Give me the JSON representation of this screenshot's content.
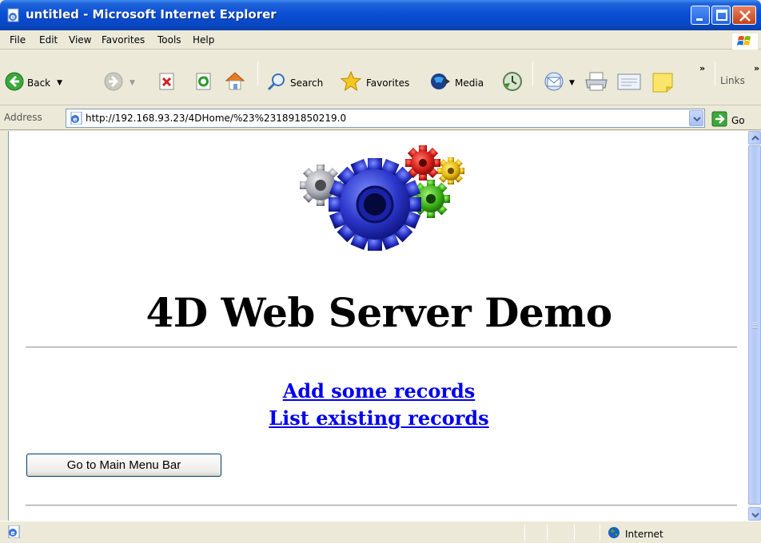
{
  "window": {
    "title": "untitled - Microsoft Internet Explorer"
  },
  "menu": {
    "items": [
      "File",
      "Edit",
      "View",
      "Favorites",
      "Tools",
      "Help"
    ]
  },
  "toolbar": {
    "back_label": "Back",
    "search_label": "Search",
    "favorites_label": "Favorites",
    "media_label": "Media",
    "links_label": "Links"
  },
  "address": {
    "label": "Address",
    "url": "http://192.168.93.23/4DHome/%23%231891850219.0",
    "go_label": "Go"
  },
  "page": {
    "heading": "4D Web Server Demo",
    "links": [
      "Add some records",
      "List existing records"
    ],
    "main_menu_button": "Go to Main Menu Bar"
  },
  "status": {
    "zone": "Internet"
  }
}
